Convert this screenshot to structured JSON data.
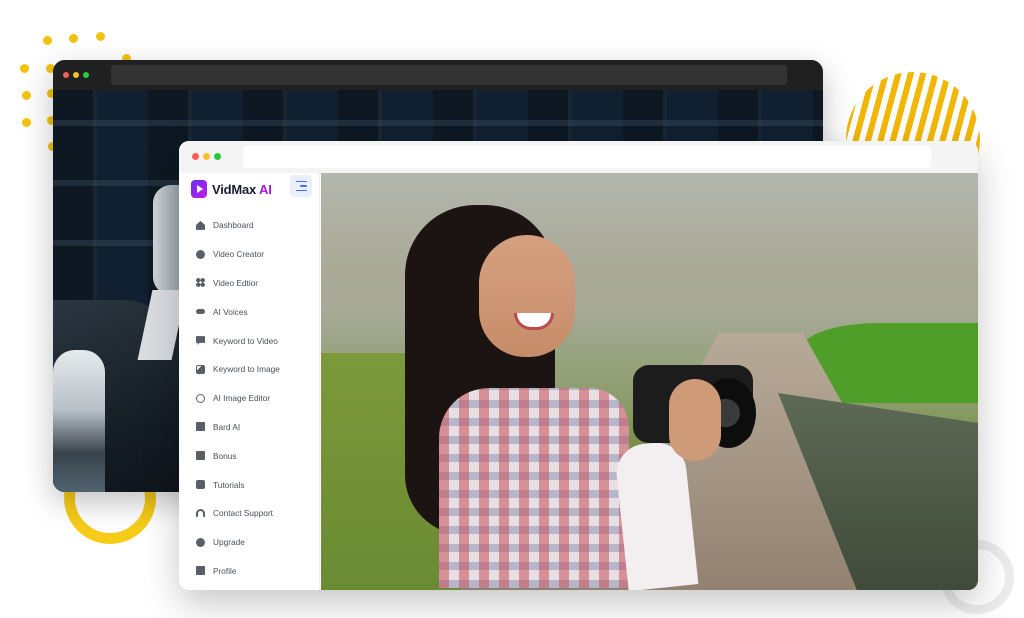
{
  "app": {
    "brand_name": "VidMax",
    "brand_suffix": "AI"
  },
  "sidebar": {
    "items": [
      {
        "label": "Dashboard",
        "icon": "home-icon"
      },
      {
        "label": "Video Creator",
        "icon": "globe-icon"
      },
      {
        "label": "Video Edtior",
        "icon": "grid-icon"
      },
      {
        "label": "AI Voices",
        "icon": "voicemail-icon"
      },
      {
        "label": "Keyword to Video",
        "icon": "chat-icon"
      },
      {
        "label": "Keyword to Image",
        "icon": "image-icon"
      },
      {
        "label": "AI Image Editor",
        "icon": "broadcast-icon"
      },
      {
        "label": "Bard AI",
        "icon": "bard-icon"
      },
      {
        "label": "Bonus",
        "icon": "gift-icon"
      },
      {
        "label": "Tutorials",
        "icon": "play-square-icon"
      },
      {
        "label": "Contact Support",
        "icon": "headphones-icon"
      },
      {
        "label": "Upgrade",
        "icon": "upgrade-icon"
      },
      {
        "label": "Profile",
        "icon": "profile-card-icon"
      }
    ]
  },
  "colors": {
    "accent": "#a11be0",
    "brand_gradient_start": "#6a2cf0",
    "toggle_bg": "#e8f0ff",
    "decor_yellow": "#f4c20d"
  }
}
